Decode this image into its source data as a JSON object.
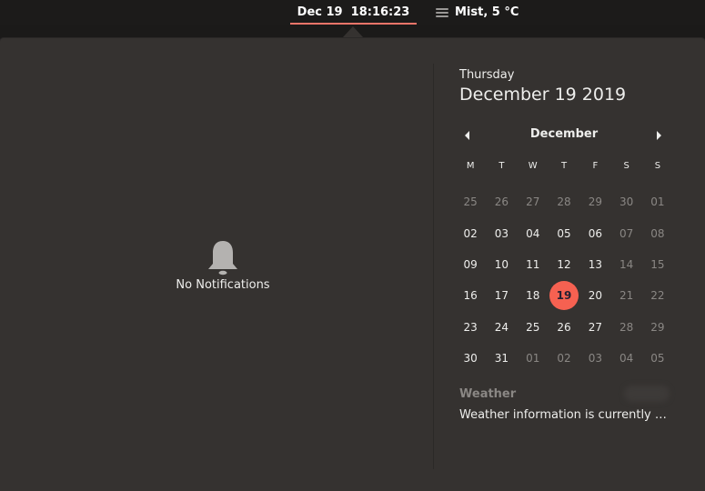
{
  "topbar": {
    "clock": "Dec 19  18:16:23",
    "weather": "Mist, 5 °C",
    "weather_icon": "fog-icon"
  },
  "notifications": {
    "icon": "bell-icon",
    "empty_label": "No Notifications"
  },
  "date_header": {
    "day_name": "Thursday",
    "full_date": "December 19 2019"
  },
  "calendar": {
    "month": "December",
    "weekdays": [
      "M",
      "T",
      "W",
      "T",
      "F",
      "S",
      "S"
    ],
    "today": "19",
    "days": [
      [
        "25",
        "26",
        "27",
        "28",
        "29",
        "30",
        "01"
      ],
      [
        "02",
        "03",
        "04",
        "05",
        "06",
        "07",
        "08"
      ],
      [
        "09",
        "10",
        "11",
        "12",
        "13",
        "14",
        "15"
      ],
      [
        "16",
        "17",
        "18",
        "19",
        "20",
        "21",
        "22"
      ],
      [
        "23",
        "24",
        "25",
        "26",
        "27",
        "28",
        "29"
      ],
      [
        "30",
        "31",
        "01",
        "02",
        "03",
        "04",
        "05"
      ]
    ],
    "muted": [
      [
        true,
        true,
        true,
        true,
        true,
        true,
        true
      ],
      [
        false,
        false,
        false,
        false,
        false,
        true,
        true
      ],
      [
        false,
        false,
        false,
        false,
        false,
        true,
        true
      ],
      [
        false,
        false,
        false,
        false,
        false,
        true,
        true
      ],
      [
        false,
        false,
        false,
        false,
        false,
        true,
        true
      ],
      [
        false,
        false,
        true,
        true,
        true,
        true,
        true
      ]
    ]
  },
  "weather_section": {
    "title": "Weather",
    "text": "Weather information is currently unavailable"
  },
  "colors": {
    "accent": "#f66151",
    "clock_underline": "#f2756a",
    "panel_bg": "#353230"
  }
}
